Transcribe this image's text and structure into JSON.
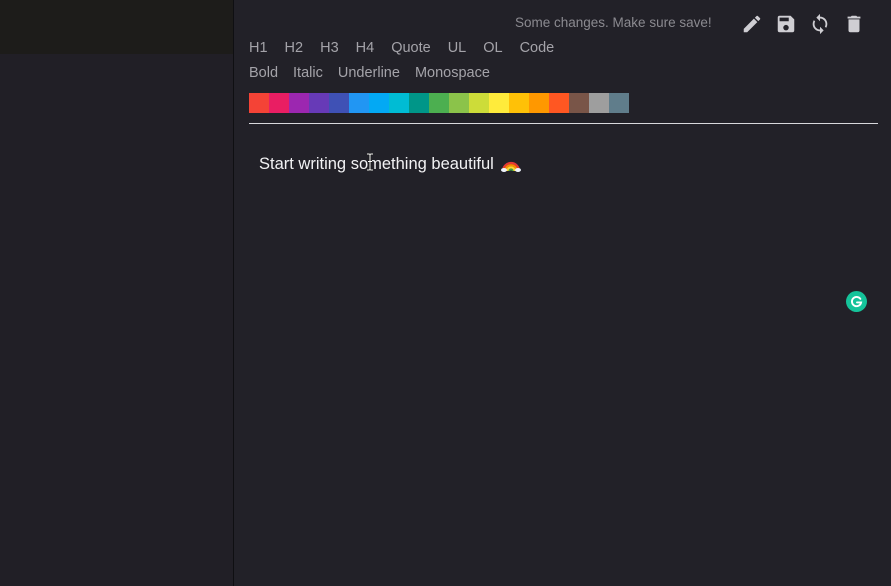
{
  "status": {
    "message": "Some changes. Make sure save!"
  },
  "actions": [
    {
      "name": "edit",
      "icon": "pencil-icon"
    },
    {
      "name": "save",
      "icon": "floppy-disk-icon"
    },
    {
      "name": "sync",
      "icon": "sync-icon"
    },
    {
      "name": "delete",
      "icon": "trash-icon"
    }
  ],
  "format": {
    "blocks": [
      "H1",
      "H2",
      "H3",
      "H4",
      "Quote",
      "UL",
      "OL",
      "Code"
    ],
    "styles": [
      "Bold",
      "Italic",
      "Underline",
      "Monospace"
    ]
  },
  "palette": [
    "#f44336",
    "#e91e63",
    "#9c27b0",
    "#673ab7",
    "#3f51b5",
    "#2196f3",
    "#03a9f4",
    "#00bcd4",
    "#009688",
    "#4caf50",
    "#8bc34a",
    "#cddc39",
    "#ffeb3b",
    "#ffc107",
    "#ff9800",
    "#ff5722",
    "#795548",
    "#9e9e9e",
    "#607d8b"
  ],
  "editor": {
    "text": "Start writing something beautiful",
    "emoji": "rainbow-icon"
  },
  "grammarly": {
    "icon": "grammarly-icon",
    "color": "#15c39a"
  }
}
